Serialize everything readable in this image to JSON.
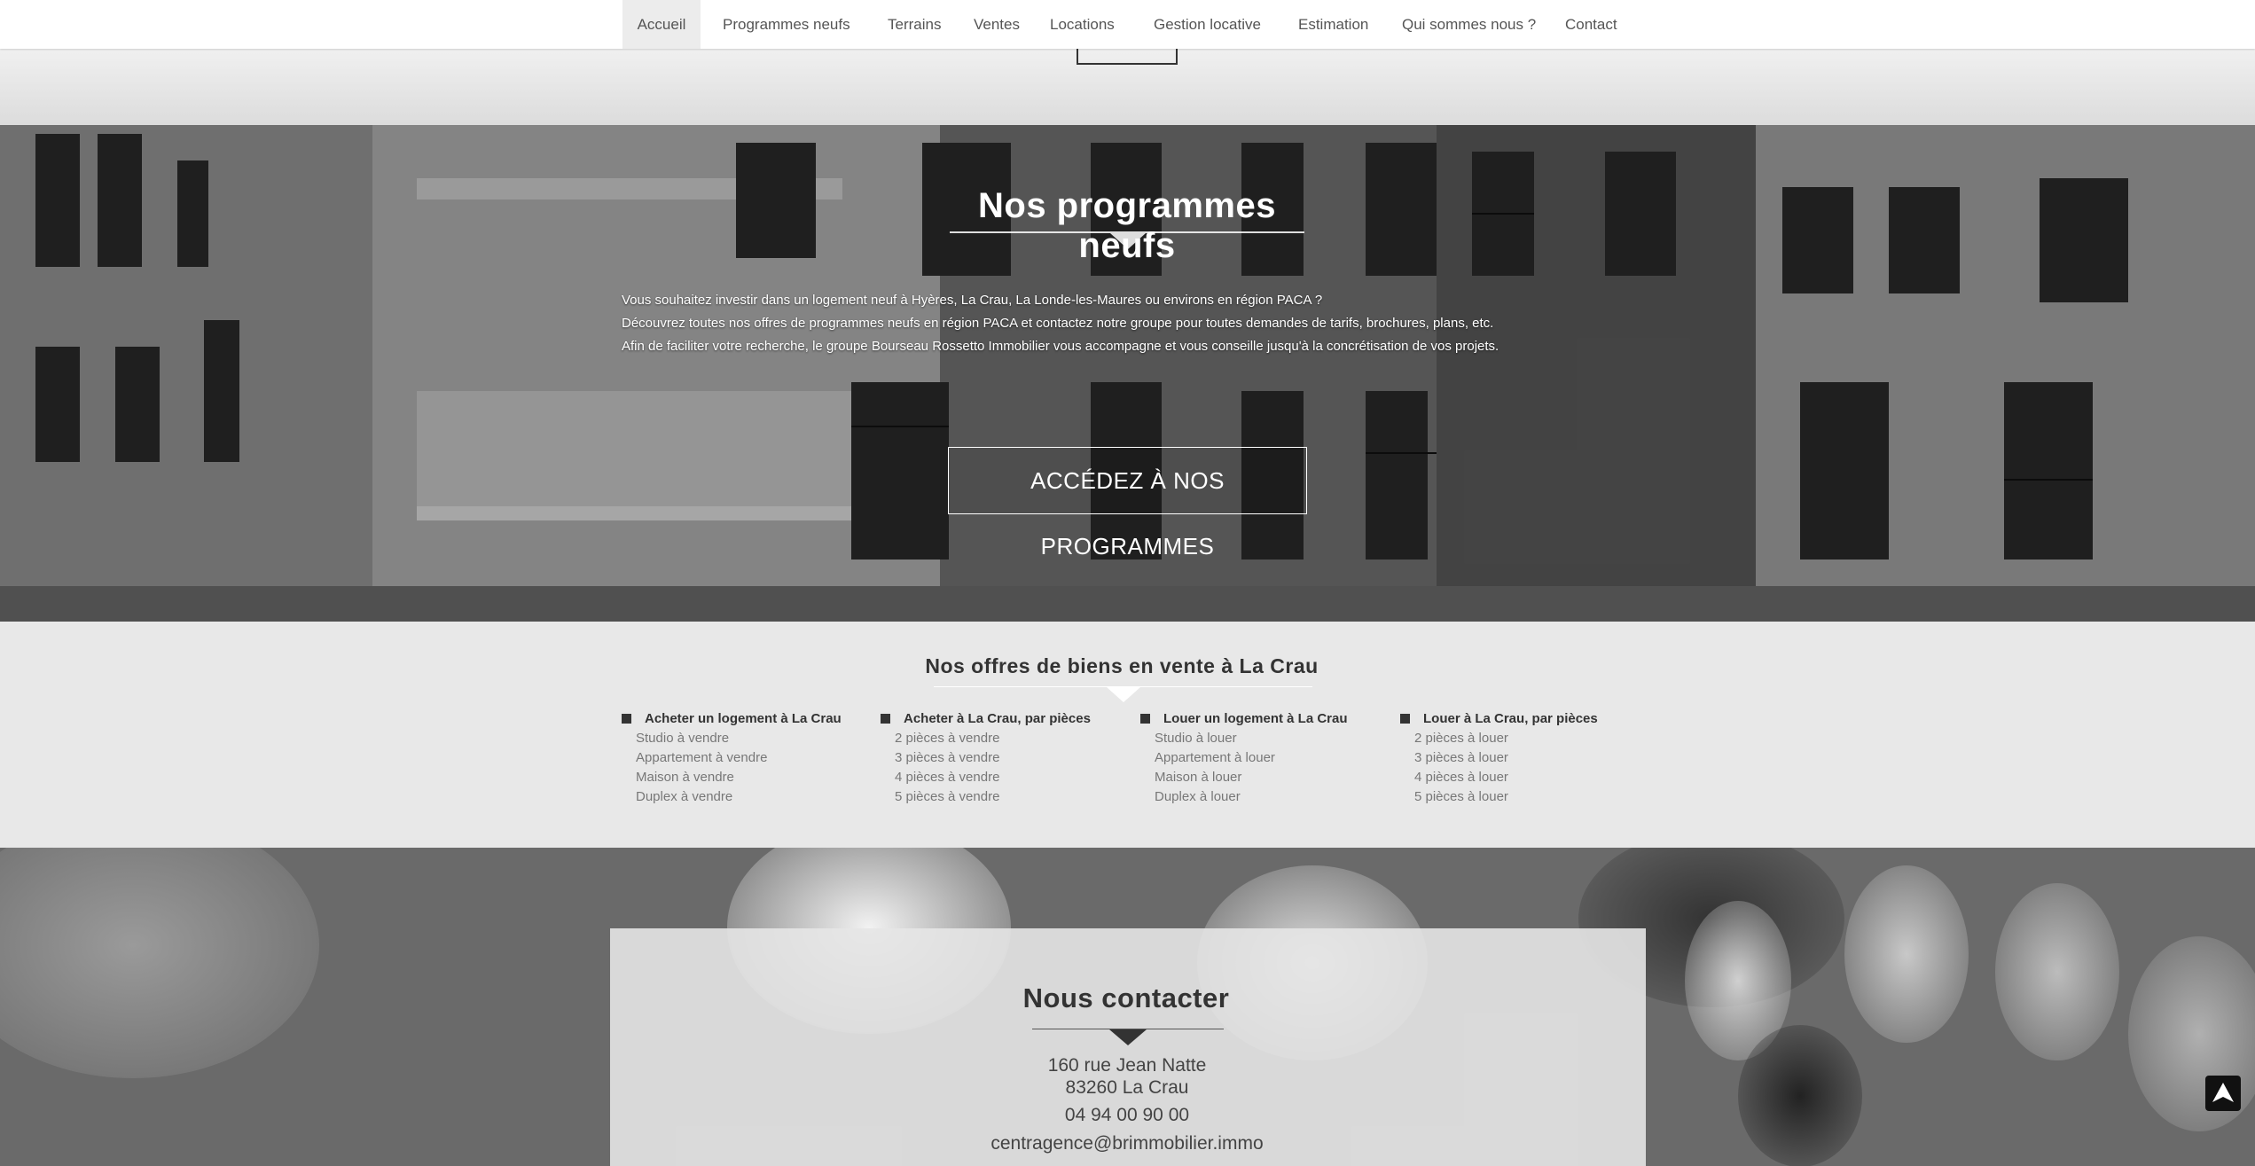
{
  "nav": {
    "items": [
      {
        "label": "Accueil",
        "active": true
      },
      {
        "label": "Programmes neufs"
      },
      {
        "label": "Terrains"
      },
      {
        "label": "Ventes"
      },
      {
        "label": "Locations"
      },
      {
        "label": "Gestion locative"
      },
      {
        "label": "Estimation"
      },
      {
        "label": "Qui sommes nous ?"
      },
      {
        "label": "Contact"
      }
    ]
  },
  "hero": {
    "title": "Nos programmes neufs",
    "paragraphs": [
      "Vous souhaitez investir dans un logement neuf à Hyères, La Crau, La Londe-les-Maures ou environs en région PACA ?",
      "Découvrez toutes nos offres de programmes neufs en région PACA et contactez notre groupe pour toutes demandes de tarifs, brochures, plans, etc.",
      "Afin de faciliter votre recherche, le groupe Bourseau Rossetto Immobilier vous accompagne et vous conseille jusqu'à la concrétisation de vos projets."
    ],
    "button_label": "ACCÉDEZ À NOS PROGRAMMES"
  },
  "offers": {
    "title": "Nos offres de biens en vente à La Crau",
    "columns": [
      {
        "heading": "Acheter un logement à La Crau",
        "links": [
          "Studio à vendre",
          "Appartement à vendre",
          "Maison à vendre",
          "Duplex à vendre"
        ]
      },
      {
        "heading": "Acheter à La Crau, par pièces",
        "links": [
          "2 pièces à vendre",
          "3 pièces à vendre",
          "4 pièces à vendre",
          "5 pièces à vendre"
        ]
      },
      {
        "heading": "Louer un logement à La Crau",
        "links": [
          "Studio à louer",
          "Appartement à louer",
          "Maison à louer",
          "Duplex à louer"
        ]
      },
      {
        "heading": "Louer à La Crau, par pièces",
        "links": [
          "2 pièces à louer",
          "3 pièces à louer",
          "4 pièces à louer",
          "5 pièces à louer"
        ]
      }
    ]
  },
  "contact": {
    "title": "Nous contacter",
    "address_line1": "160 rue Jean Natte",
    "address_line2": "83260 La Crau",
    "phone": "04 94 00 90 00",
    "email": "centragence@brimmobilier.immo"
  },
  "icons": {
    "scroll_top": "arrow-up-icon"
  }
}
